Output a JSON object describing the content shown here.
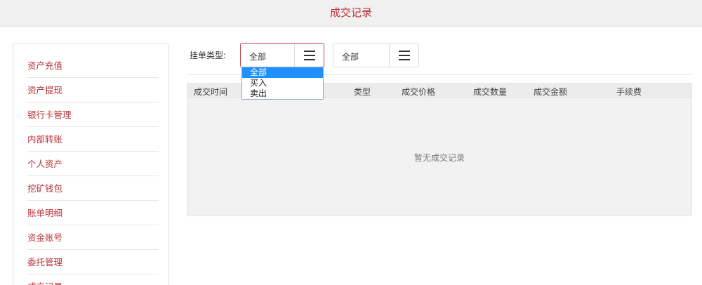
{
  "header": {
    "title": "成交记录"
  },
  "sidebar": {
    "items": [
      {
        "label": "资产充值"
      },
      {
        "label": "资产提现"
      },
      {
        "label": "银行卡管理"
      },
      {
        "label": "内部转账"
      },
      {
        "label": "个人资产"
      },
      {
        "label": "挖矿钱包"
      },
      {
        "label": "账单明细"
      },
      {
        "label": "资金账号"
      },
      {
        "label": "委托管理"
      },
      {
        "label": "成交记录"
      }
    ]
  },
  "filter": {
    "label": "挂单类型:",
    "select1_value": "全部",
    "select2_value": "全部",
    "dropdown_options": [
      "全部",
      "买入",
      "卖出"
    ]
  },
  "table": {
    "columns": [
      "成交时间",
      "类型",
      "成交价格",
      "成交数量",
      "成交金额",
      "手续费"
    ],
    "empty_text": "暂无成交记录"
  },
  "colors": {
    "accent": "#c0313a",
    "selected_option": "#1e90ff"
  }
}
